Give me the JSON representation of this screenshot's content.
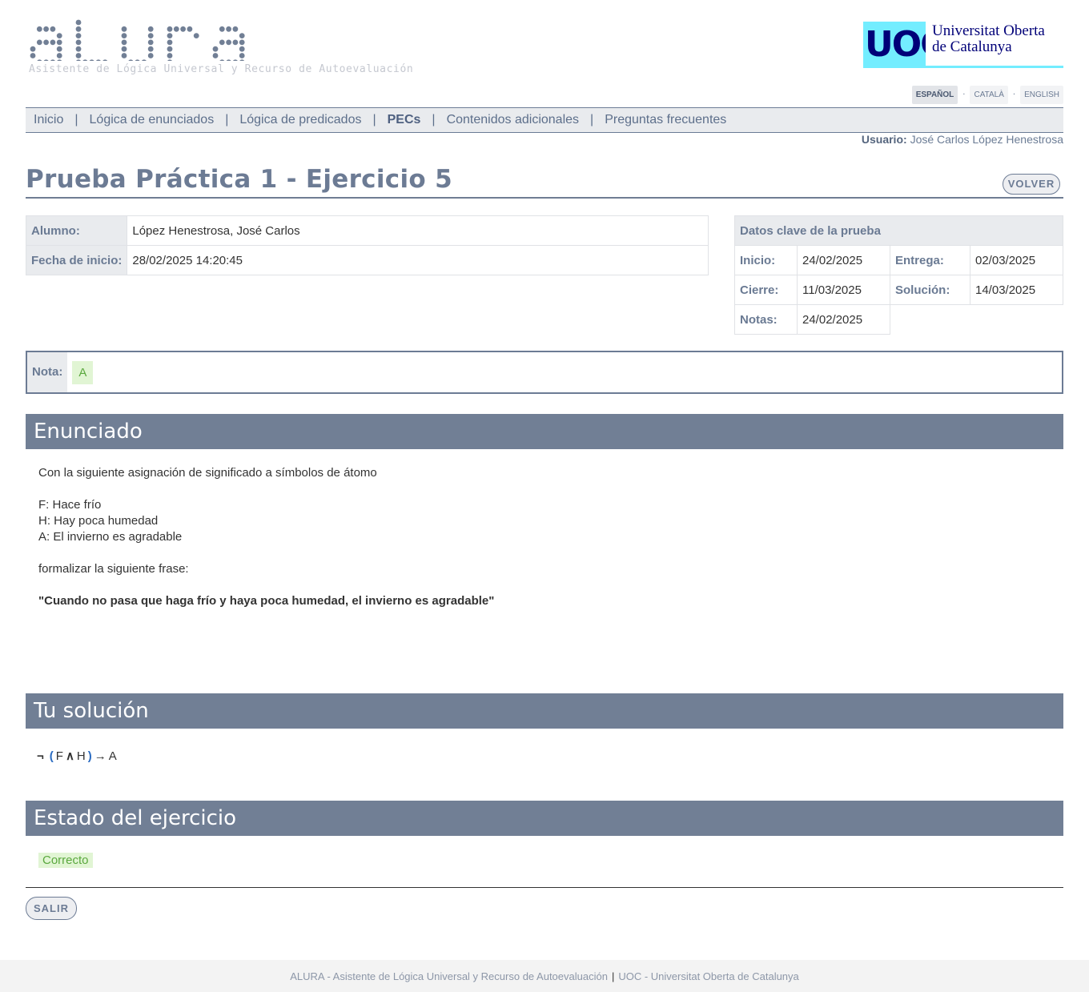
{
  "header": {
    "logo_text": "ALURA",
    "logo_subtitle": "Asistente de Lógica Universal y Recurso de Autoevaluación",
    "uoc_mark": "UOC",
    "uoc_name_line1": "Universitat Oberta",
    "uoc_name_line2": "de Catalunya"
  },
  "languages": [
    {
      "label": "ESPAÑOL",
      "active": true
    },
    {
      "label": "CATALÀ",
      "active": false
    },
    {
      "label": "ENGLISH",
      "active": false
    }
  ],
  "lang_separator": "·",
  "nav": {
    "items": [
      "Inicio",
      "Lógica de enunciados",
      "Lógica de predicados",
      "PECs",
      "Contenidos adicionales",
      "Preguntas frecuentes"
    ],
    "active": "PECs",
    "separator": "|"
  },
  "user": {
    "label": "Usuario:",
    "name": "José Carlos López Henestrosa"
  },
  "page": {
    "title": "Prueba Práctica 1 - Ejercicio 5",
    "back_button": "VOLVER"
  },
  "student": {
    "alumno_label": "Alumno:",
    "alumno_value": "López Henestrosa, José Carlos",
    "fecha_label": "Fecha de inicio:",
    "fecha_value": "28/02/2025 14:20:45"
  },
  "key_data": {
    "title": "Datos clave de la prueba",
    "inicio_label": "Inicio:",
    "inicio_value": "24/02/2025",
    "entrega_label": "Entrega:",
    "entrega_value": "02/03/2025",
    "cierre_label": "Cierre:",
    "cierre_value": "11/03/2025",
    "solucion_label": "Solución:",
    "solucion_value": "14/03/2025",
    "notas_label": "Notas:",
    "notas_value": "24/02/2025"
  },
  "grade": {
    "label": "Nota:",
    "value": "A",
    "color": "#5aa83e",
    "bg": "#e1f5d4"
  },
  "enunciado": {
    "heading": "Enunciado",
    "intro": "Con la siguiente asignación de significado a símbolos de átomo",
    "atoms": [
      "F: Hace frío",
      "H: Hay poca humedad",
      "A: El invierno es agradable"
    ],
    "instruction": "formalizar la siguiente frase:",
    "sentence": "\"Cuando no pasa que haga frío y haya poca humedad, el invierno es agradable\""
  },
  "solution": {
    "heading": "Tu solución",
    "tokens": {
      "neg": "¬",
      "lparen": "(",
      "atom1": "F",
      "and": "∧",
      "atom2": "H",
      "rparen": ")",
      "implies": "→",
      "atom3": "A"
    }
  },
  "status": {
    "heading": "Estado del ejercicio",
    "value": "Correcto"
  },
  "exit_button": "SALIR",
  "footer": {
    "left": "ALURA - Asistente de Lógica Universal y Recurso de Autoevaluación",
    "sep": "|",
    "right": "UOC - Universitat Oberta de Catalunya"
  },
  "colors": {
    "accent": "#717f95",
    "uoc_cyan": "#73EDFF",
    "uoc_navy": "#000078"
  }
}
